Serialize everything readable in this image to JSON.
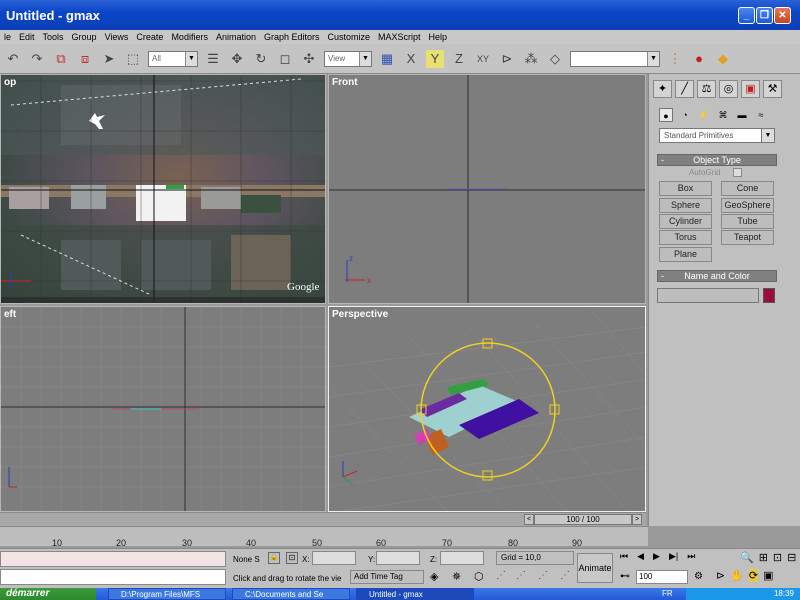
{
  "window": {
    "title": "Untitled - gmax",
    "min": "_",
    "max": "❐",
    "close": "✕"
  },
  "menu": [
    "le",
    "Edit",
    "Tools",
    "Group",
    "Views",
    "Create",
    "Modifiers",
    "Animation",
    "Graph Editors",
    "Customize",
    "MAXScript",
    "Help"
  ],
  "toolbar": {
    "selection_filter": "All",
    "coord_system": "View",
    "named_selection": ""
  },
  "viewports": {
    "top": {
      "label": "op",
      "watermark": "Google"
    },
    "front": {
      "label": "Front"
    },
    "left": {
      "label": "eft"
    },
    "perspective": {
      "label": "Perspective"
    }
  },
  "command_panel": {
    "dropdown": "Standard Primitives",
    "object_type": {
      "title": "Object Type",
      "minus": "-",
      "autogrid": "AutoGrid",
      "buttons": [
        "Box",
        "Cone",
        "Sphere",
        "GeoSphere",
        "Cylinder",
        "Tube",
        "Torus",
        "Teapot",
        "Plane"
      ]
    },
    "name_color": {
      "title": "Name and Color",
      "minus": "-",
      "name": "",
      "color": "#9a0f3a"
    }
  },
  "timeline": {
    "frame": "100 / 100",
    "ticks": [
      "10",
      "20",
      "30",
      "40",
      "50",
      "60",
      "70",
      "80",
      "90"
    ]
  },
  "status": {
    "selection": "None S",
    "x_label": "X:",
    "y_label": "Y:",
    "z_label": "Z:",
    "grid": "Grid = 10,0",
    "prompt": "Click and drag to rotate the vie",
    "add_time_tag": "Add Time Tag",
    "animate": "Animate",
    "frame_field": "100"
  },
  "taskbar": {
    "start": "démarrer",
    "tasks": [
      "D:\\Program Files\\MFS",
      "C:\\Documents and Se",
      "Untitled - gmax"
    ],
    "lang": "FR",
    "clock": "18:39"
  }
}
